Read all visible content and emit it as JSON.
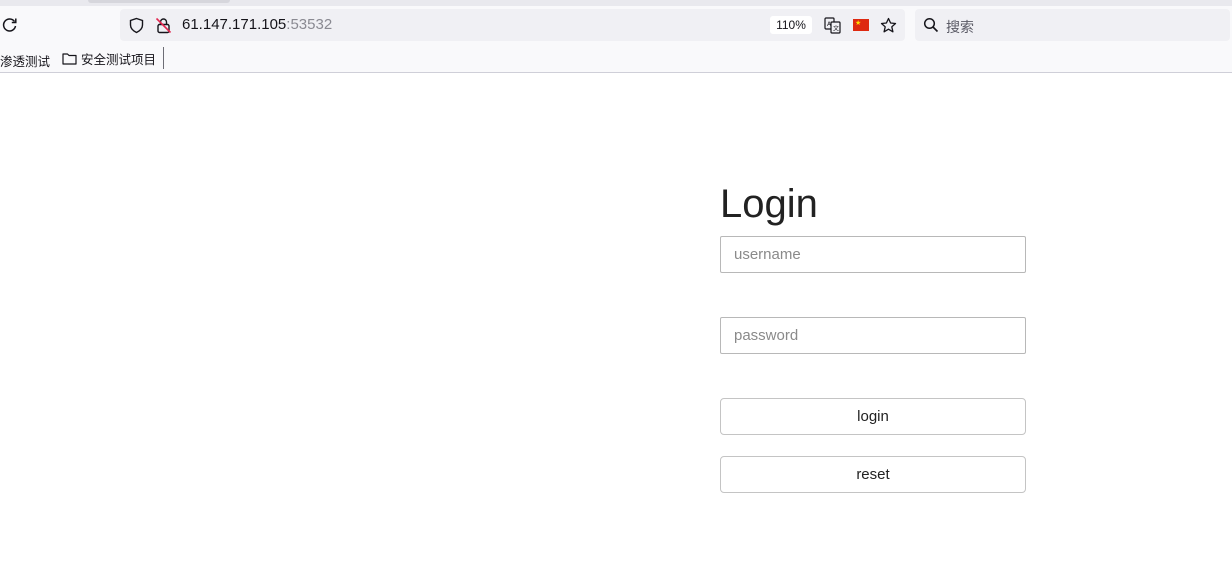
{
  "browser": {
    "url_host": "61.147.171.105",
    "url_port": ":53532",
    "zoom": "110%",
    "search_placeholder": "搜索",
    "bookmarks": [
      {
        "label": "渗透测试"
      },
      {
        "label": "安全测试项目"
      }
    ],
    "flag_color": "#de2910",
    "icons": [
      "reload-icon",
      "shield-icon",
      "lock-warning-icon",
      "translate-icon",
      "china-flag-icon",
      "star-icon",
      "search-icon",
      "folder-icon"
    ]
  },
  "login": {
    "title": "Login",
    "username_placeholder": "username",
    "password_placeholder": "password",
    "login_label": "login",
    "reset_label": "reset"
  }
}
